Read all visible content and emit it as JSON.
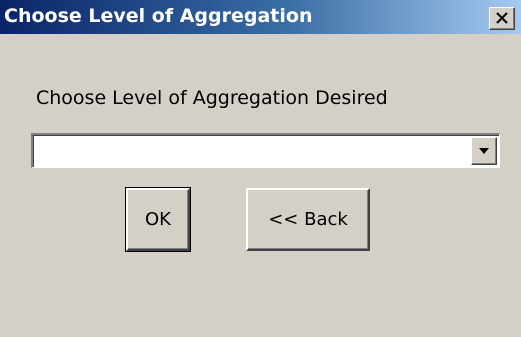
{
  "window": {
    "title": "Choose Level of Aggregation",
    "colors": {
      "titlebar_start": "#0a246a",
      "titlebar_end": "#a6caf0",
      "face": "#d4d0c8"
    }
  },
  "dialog": {
    "prompt": "Choose Level of Aggregation Desired",
    "dropdown": {
      "selected_value": ""
    },
    "ok_label": "OK",
    "back_label": "<< Back"
  },
  "icons": {
    "close": "close-icon",
    "dropdown": "chevron-down-icon"
  }
}
